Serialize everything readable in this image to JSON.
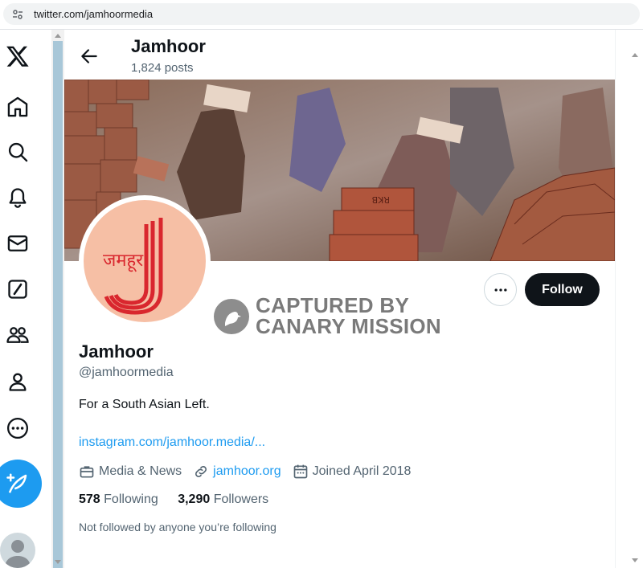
{
  "browser": {
    "url": "twitter.com/jamhoormedia"
  },
  "nav": {
    "icons": [
      "x-logo-icon",
      "home-icon",
      "search-icon",
      "bell-icon",
      "mail-icon",
      "grok-icon",
      "communities-icon",
      "profile-icon",
      "more-icon",
      "post-icon"
    ]
  },
  "header": {
    "name": "Jamhoor",
    "posts": "1,824 posts"
  },
  "profile": {
    "avatar_text": "जमहूर",
    "name": "Jamhoor",
    "handle": "@jamhoormedia",
    "bio": "For a South Asian Left.",
    "link": "instagram.com/jamhoor.media/...",
    "category": "Media & News",
    "website": "jamhoor.org",
    "joined": "Joined April 2018",
    "following_count": "578",
    "following_label": "Following",
    "followers_count": "3,290",
    "followers_label": "Followers",
    "not_followed": "Not followed by anyone you’re following"
  },
  "actions": {
    "follow_label": "Follow"
  },
  "watermark": {
    "line1": "CAPTURED BY",
    "line2": "CANARY MISSION"
  },
  "colors": {
    "accent": "#1d9bf0",
    "follow_bg": "#0f1419",
    "avatar_bg": "#f6bfa5",
    "avatar_red": "#d9272e"
  }
}
